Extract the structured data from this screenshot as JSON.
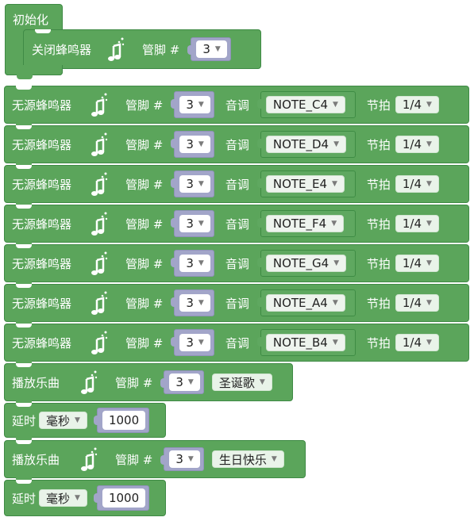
{
  "init": {
    "label": "初始化",
    "inner": {
      "label": "关闭蜂鸣器",
      "pin_label": "管脚 #",
      "pin": "3"
    }
  },
  "buzzers": [
    {
      "label": "无源蜂鸣器",
      "pin_label": "管脚 #",
      "pin": "3",
      "tone_label": "音调",
      "note": "NOTE_C4",
      "beat_label": "节拍",
      "beat": "1/4"
    },
    {
      "label": "无源蜂鸣器",
      "pin_label": "管脚 #",
      "pin": "3",
      "tone_label": "音调",
      "note": "NOTE_D4",
      "beat_label": "节拍",
      "beat": "1/4"
    },
    {
      "label": "无源蜂鸣器",
      "pin_label": "管脚 #",
      "pin": "3",
      "tone_label": "音调",
      "note": "NOTE_E4",
      "beat_label": "节拍",
      "beat": "1/4"
    },
    {
      "label": "无源蜂鸣器",
      "pin_label": "管脚 #",
      "pin": "3",
      "tone_label": "音调",
      "note": "NOTE_F4",
      "beat_label": "节拍",
      "beat": "1/4"
    },
    {
      "label": "无源蜂鸣器",
      "pin_label": "管脚 #",
      "pin": "3",
      "tone_label": "音调",
      "note": "NOTE_G4",
      "beat_label": "节拍",
      "beat": "1/4"
    },
    {
      "label": "无源蜂鸣器",
      "pin_label": "管脚 #",
      "pin": "3",
      "tone_label": "音调",
      "note": "NOTE_A4",
      "beat_label": "节拍",
      "beat": "1/4"
    },
    {
      "label": "无源蜂鸣器",
      "pin_label": "管脚 #",
      "pin": "3",
      "tone_label": "音调",
      "note": "NOTE_B4",
      "beat_label": "节拍",
      "beat": "1/4"
    }
  ],
  "play1": {
    "label": "播放乐曲",
    "pin_label": "管脚 #",
    "pin": "3",
    "song": "圣诞歌"
  },
  "delay1": {
    "label": "延时",
    "unit": "毫秒",
    "value": "1000"
  },
  "play2": {
    "label": "播放乐曲",
    "pin_label": "管脚 #",
    "pin": "3",
    "song": "生日快乐"
  },
  "delay2": {
    "label": "延时",
    "unit": "毫秒",
    "value": "1000"
  },
  "icons": {
    "music": "music-note-icon",
    "dropdown": "dropdown-caret-icon"
  },
  "colors": {
    "block": "#5ba55b",
    "block_border": "#3f8a45",
    "math_slot": "#a2a5c9"
  }
}
